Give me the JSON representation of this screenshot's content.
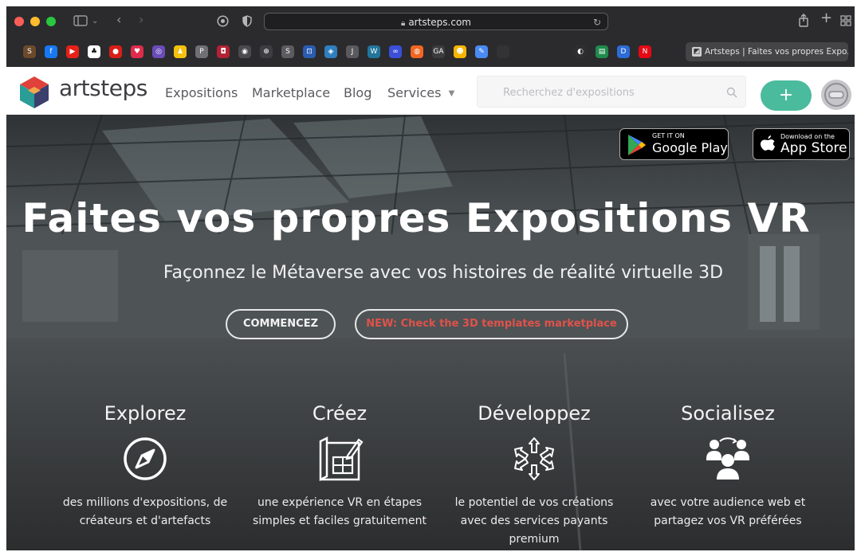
{
  "browser": {
    "url": "artsteps.com",
    "active_tab_title": "Artsteps | Faites vos propres Expo..."
  },
  "favorites": [
    {
      "icon": "generic-favicon-icon",
      "color": "#6b4a2b",
      "glyph": "S"
    },
    {
      "icon": "facebook-icon",
      "color": "#1877f2",
      "glyph": "f"
    },
    {
      "icon": "youtube-icon",
      "color": "#e62117",
      "glyph": "▶"
    },
    {
      "icon": "generic-favicon-icon",
      "color": "#ffffff",
      "glyph": "♣"
    },
    {
      "icon": "generic-favicon-icon",
      "color": "#d91e18",
      "glyph": "●"
    },
    {
      "icon": "heart-icon",
      "color": "#e02b4b",
      "glyph": "♥"
    },
    {
      "icon": "generic-favicon-icon",
      "color": "#6a4cb8",
      "glyph": "◎"
    },
    {
      "icon": "generic-favicon-icon",
      "color": "#f4c20d",
      "glyph": "♟"
    },
    {
      "icon": "generic-favicon-icon",
      "color": "#6f6f74",
      "glyph": "P"
    },
    {
      "icon": "generic-favicon-icon",
      "color": "#b22234",
      "glyph": "◘"
    },
    {
      "icon": "generic-favicon-icon",
      "color": "#4a4a4e",
      "glyph": "◉"
    },
    {
      "icon": "generic-favicon-icon",
      "color": "#3d3d41",
      "glyph": "⊕"
    },
    {
      "icon": "generic-favicon-icon",
      "color": "#5c5c60",
      "glyph": "S"
    },
    {
      "icon": "generic-favicon-icon",
      "color": "#2a5db0",
      "glyph": "⊡"
    },
    {
      "icon": "generic-favicon-icon",
      "color": "#2f7fbf",
      "glyph": "◈"
    },
    {
      "icon": "generic-favicon-icon",
      "color": "#5a5a5e",
      "glyph": "J"
    },
    {
      "icon": "wordpress-icon",
      "color": "#21759b",
      "glyph": "W"
    },
    {
      "icon": "generic-favicon-icon",
      "color": "#3b4fd8",
      "glyph": "∞"
    },
    {
      "icon": "generic-favicon-icon",
      "color": "#f26522",
      "glyph": "◍"
    },
    {
      "icon": "generic-favicon-icon",
      "color": "#3c3c3f",
      "glyph": "GA"
    },
    {
      "icon": "generic-favicon-icon",
      "color": "#f7b500",
      "glyph": "☻"
    },
    {
      "icon": "generic-favicon-icon",
      "color": "#4a8af4",
      "glyph": "✎"
    },
    {
      "icon": "generic-favicon-icon",
      "color": "#333336",
      "glyph": " "
    },
    {
      "icon": "generic-favicon-icon",
      "color": "#2e2e31",
      "glyph": "◐"
    },
    {
      "icon": "generic-favicon-icon",
      "color": "#1f8b4c",
      "glyph": "▤"
    },
    {
      "icon": "generic-favicon-icon",
      "color": "#2d6bd6",
      "glyph": "D"
    },
    {
      "icon": "netflix-icon",
      "color": "#e50914",
      "glyph": "N"
    }
  ],
  "site": {
    "logo_text": "artsteps",
    "nav": [
      {
        "label": "Expositions"
      },
      {
        "label": "Marketplace"
      },
      {
        "label": "Blog"
      },
      {
        "label": "Services"
      }
    ],
    "search_placeholder": "Recherchez d'expositions",
    "add_label": "+"
  },
  "hero": {
    "google_play": {
      "small": "GET IT ON",
      "big": "Google Play"
    },
    "app_store": {
      "small": "Download on the",
      "big": "App Store"
    },
    "title": "Faites vos propres Expositions VR",
    "subtitle": "Façonnez le Métaverse avec vos histoires de réalité virtuelle 3D",
    "btn_start": "COMMENCEZ",
    "btn_new": "NEW: Check the 3D templates marketplace",
    "features": [
      {
        "title": "Explorez",
        "icon": "compass-icon",
        "text_lines": [
          "des millions d'expositions, de",
          "créateurs et d'artefacts"
        ]
      },
      {
        "title": "Créez",
        "icon": "blueprint-icon",
        "text_lines": [
          "une expérience VR en étapes",
          "simples et faciles gratuitement"
        ]
      },
      {
        "title": "Développez",
        "icon": "expand-arrows-icon",
        "text_lines": [
          "le potentiel de vos créations",
          "avec des services payants",
          "premium"
        ]
      },
      {
        "title": "Socialisez",
        "icon": "users-group-icon",
        "text_lines": [
          "avec votre audience web et",
          "partagez vos VR préférées"
        ]
      }
    ]
  },
  "colors": {
    "accent_green": "#4bbb9d",
    "new_button_text": "#e0524a",
    "logo_red": "#e0413b",
    "logo_teal": "#2a9d96"
  }
}
